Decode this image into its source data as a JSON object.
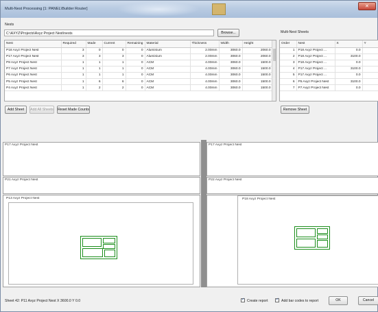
{
  "window": {
    "title": "Multi-Nest Processing [1: PANEL\\Builder Router]",
    "close_label": "✕"
  },
  "nests_section": {
    "label": "Nests",
    "path": "C:\\AXYZ\\Projects\\Axyz Project Nest\\nests",
    "browse_label": "Browse...",
    "columns": [
      "Nest",
      "Required",
      "Made",
      "Current",
      "Remaining",
      "Material",
      "Thickness",
      "Width",
      "Height"
    ],
    "rows": [
      [
        "P18 Axyz Project Nest",
        "3",
        "0",
        "0",
        "0",
        "Aluminium",
        "2.00mm",
        "3060.0",
        "2060.0"
      ],
      [
        "P17 Axyz Project Nest",
        "3",
        "3",
        "3",
        "0",
        "Aluminium",
        "2.00mm",
        "3060.0",
        "2060.0"
      ],
      [
        "P8 Axyz Project Nest",
        "1",
        "1",
        "1",
        "0",
        "ACM",
        "4.00mm",
        "3060.0",
        "1500.0"
      ],
      [
        "P7 Axyz Project Nest",
        "1",
        "1",
        "1",
        "0",
        "ACM",
        "4.00mm",
        "3060.0",
        "1500.0"
      ],
      [
        "P6 Axyz Project Nest",
        "1",
        "1",
        "1",
        "0",
        "ACM",
        "4.00mm",
        "3060.0",
        "1500.0"
      ],
      [
        "P5 Axyz Project Nest",
        "1",
        "6",
        "6",
        "0",
        "ACM",
        "4.00mm",
        "3060.0",
        "1500.0"
      ],
      [
        "P4 Axyz Project Nest",
        "1",
        "2",
        "2",
        "0",
        "ACM",
        "4.00mm",
        "3060.0",
        "1500.0"
      ]
    ],
    "add_sheet_label": "Add Sheet",
    "add_all_sheets_label": "Add All Sheets",
    "reset_counts_label": "Reset Made Counts"
  },
  "multinest_section": {
    "label": "Multi-Nest Sheets",
    "columns": [
      "Order",
      "Nest",
      "X",
      "Y"
    ],
    "rows": [
      [
        "1",
        "P18 Axyz Project ...",
        "0.0",
        "0.0"
      ],
      [
        "2",
        "P18 Axyz Project ...",
        "3100.0",
        "0.0"
      ],
      [
        "3",
        "P18 Axyz Project ...",
        "0.0",
        "0.0"
      ],
      [
        "4",
        "P17 Axyz Project ...",
        "3100.0",
        "0.0"
      ],
      [
        "5",
        "P17 Axyz Project ...",
        "0.0",
        "0.0"
      ],
      [
        "6",
        "P5 Axyz Project Nest",
        "3100.0",
        "0.0"
      ],
      [
        "7",
        "P7 Axyz Project Nest",
        "0.0",
        "0.0"
      ]
    ],
    "remove_sheet_label": "Remove Sheet"
  },
  "previews_left": [
    {
      "title": "P17 Axyz Project Nest"
    },
    {
      "title": "P21 Axyz Project Nest"
    },
    {
      "title": "P13 Axyz Project Nest"
    }
  ],
  "previews_right": [
    {
      "title": "P17 Axyz Project Nest"
    },
    {
      "title": "P22 Axyz Project Nest"
    },
    {
      "title": "P18 Axyz Project Nest"
    }
  ],
  "status": {
    "text": "Sheet 42: P11 Axyz Project Nest  X 3600.0  Y 0.0",
    "create_report_label": "Create report",
    "barcodes_label": "Add bar codes to report",
    "ok_label": "OK",
    "cancel_label": "Cancel"
  },
  "colors": {
    "nest_outline": "#1a8d1a",
    "splitter": "#8f8f8f"
  }
}
